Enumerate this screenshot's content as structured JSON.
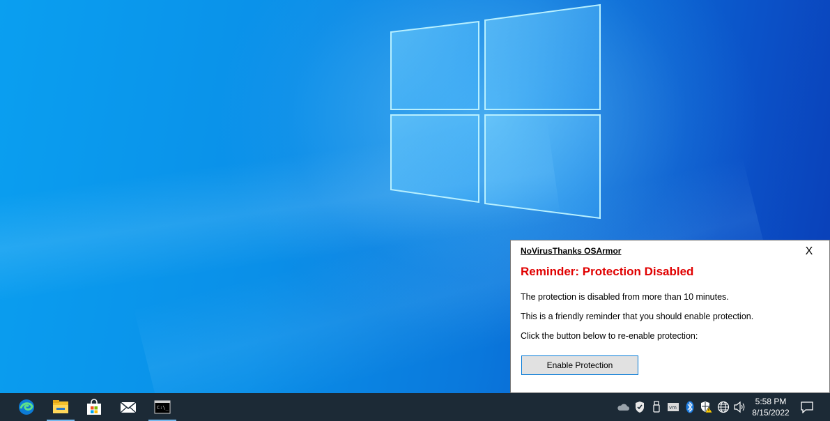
{
  "taskbar": {
    "apps": [
      {
        "name": "edge-icon",
        "active": false
      },
      {
        "name": "file-explorer-icon",
        "active": true
      },
      {
        "name": "store-icon",
        "active": false
      },
      {
        "name": "mail-icon",
        "active": false
      },
      {
        "name": "terminal-icon",
        "active": true
      }
    ],
    "tray_icons": [
      "onedrive-icon",
      "shield-icon",
      "usb-icon",
      "vmware-icon",
      "bluetooth-icon",
      "security-warning-icon",
      "network-icon",
      "volume-icon"
    ],
    "clock": {
      "time": "5:58 PM",
      "date": "8/15/2022"
    },
    "notification_center_icon": "action-center-icon"
  },
  "notification": {
    "app_name": "NoVirusThanks OSArmor",
    "close_label": "X",
    "heading": "Reminder: Protection Disabled",
    "lines": [
      "The protection is disabled from more than 10 minutes.",
      "This is a friendly reminder that you should enable protection.",
      "Click the button below to re-enable protection:"
    ],
    "button_label": "Enable Protection"
  },
  "colors": {
    "heading": "#e00000",
    "taskbar": "#1c2a36",
    "button_border": "#0078d7"
  }
}
